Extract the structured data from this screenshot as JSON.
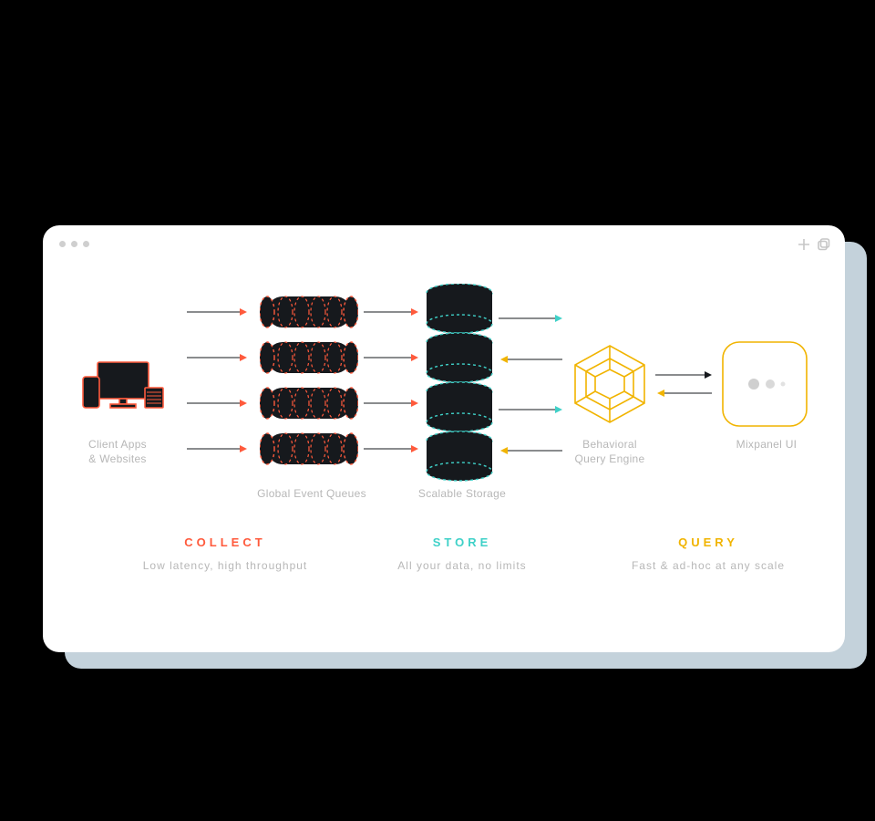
{
  "nodes": {
    "client": {
      "label_line1": "Client Apps",
      "label_line2": "& Websites"
    },
    "queues": {
      "label": "Global Event Queues"
    },
    "storage": {
      "label": "Scalable Storage"
    },
    "engine": {
      "label_line1": "Behavioral",
      "label_line2": "Query Engine"
    },
    "ui": {
      "label": "Mixpanel UI"
    }
  },
  "sections": {
    "collect": {
      "title": "COLLECT",
      "sub": "Low latency, high throughput",
      "color": "#ff5a3c"
    },
    "store": {
      "title": "STORE",
      "sub": "All your data, no limits",
      "color": "#3fd1c8"
    },
    "query": {
      "title": "QUERY",
      "sub": "Fast & ad-hoc at any scale",
      "color": "#f1b400"
    }
  },
  "colors": {
    "orange": "#ff5a3c",
    "teal": "#3fd1c8",
    "yellow": "#f1b400",
    "dark": "#16191d",
    "grey": "#b7b7b7"
  }
}
